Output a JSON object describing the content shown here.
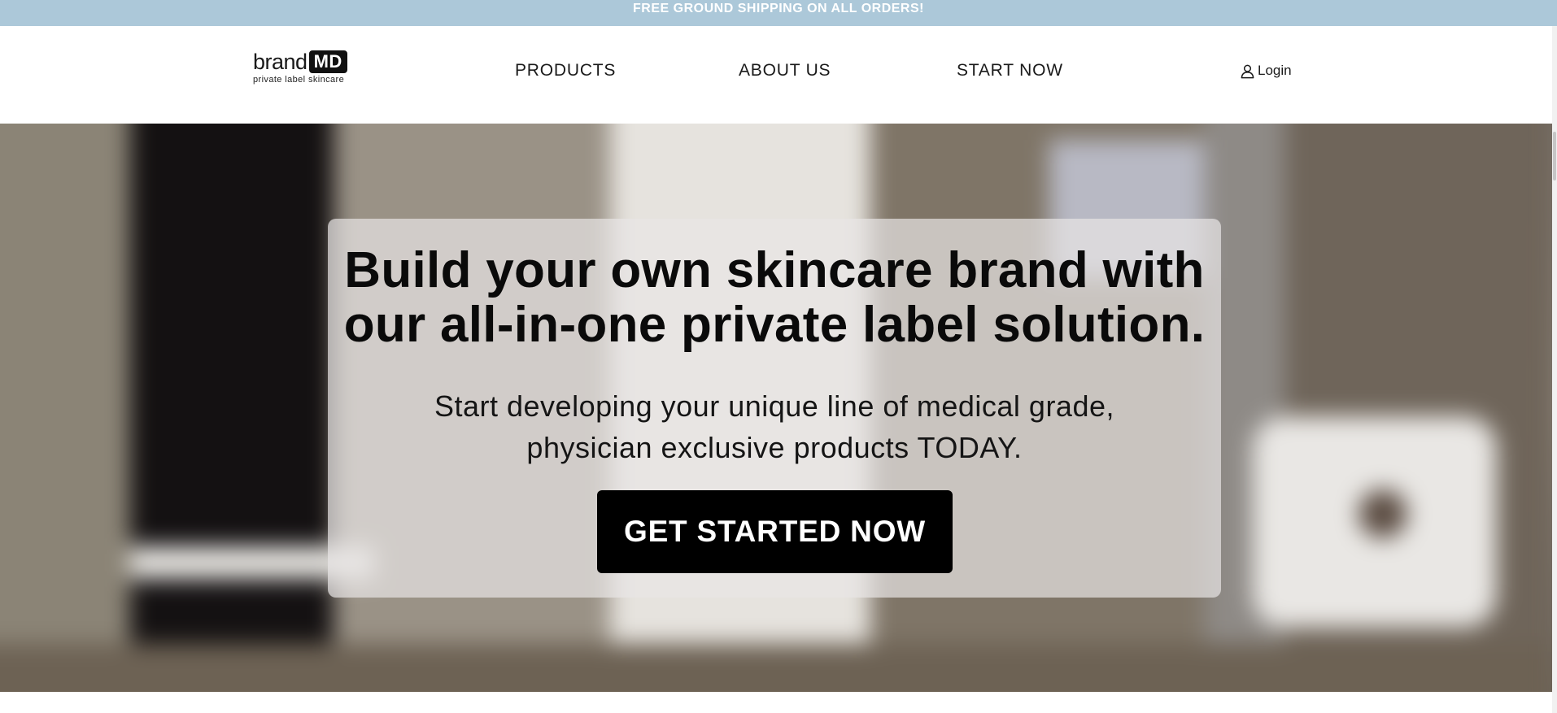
{
  "promo": {
    "text": "FREE GROUND SHIPPING ON ALL ORDERS!"
  },
  "logo": {
    "brand": "brand",
    "md": "MD",
    "tagline": "private label skincare"
  },
  "nav": {
    "products": "PRODUCTS",
    "about": "ABOUT US",
    "start": "START NOW"
  },
  "login": {
    "label": "Login",
    "icon": "user-icon"
  },
  "hero": {
    "title_line1": "Build your own skincare brand with",
    "title_line2": "our all-in-one private label solution.",
    "subtitle_line1": "Start developing your unique line of medical grade,",
    "subtitle_line2": "physician exclusive products TODAY.",
    "cta": "GET STARTED NOW"
  },
  "colors": {
    "promo_bg": "#acc8d9",
    "cta_bg": "#000000",
    "cta_text": "#ffffff"
  }
}
